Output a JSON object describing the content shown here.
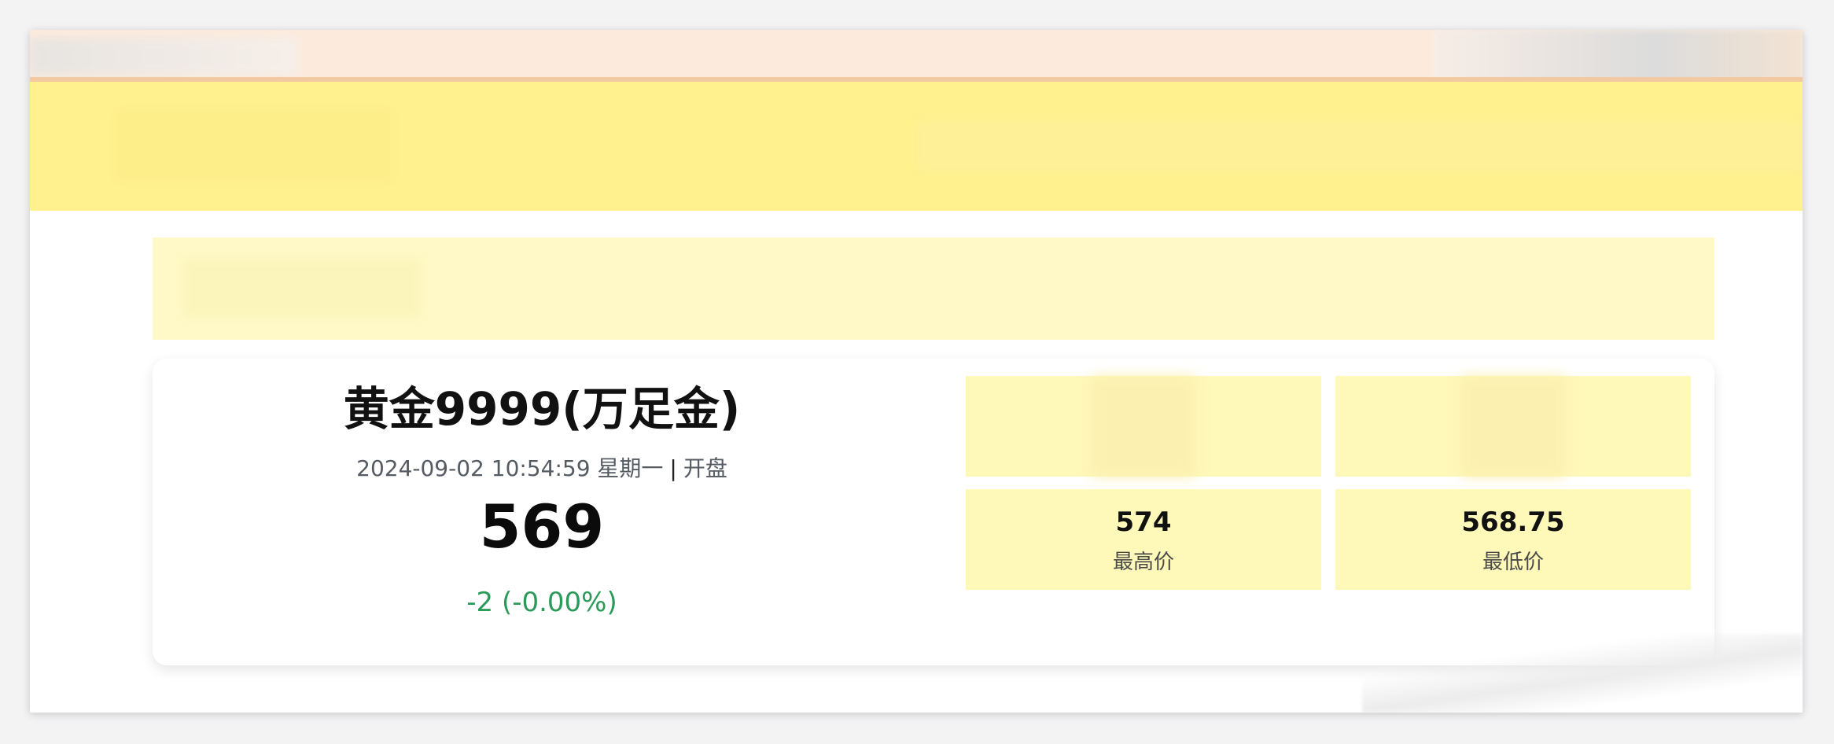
{
  "product": {
    "title": "黄金9999(万足金)",
    "timestamp": "2024-09-02 10:54:59 星期一",
    "separator": "|",
    "status": "开盘",
    "price": "569",
    "change": "-2 (-0.00%)"
  },
  "stats": [
    {
      "value": "",
      "label": ""
    },
    {
      "value": "",
      "label": ""
    },
    {
      "value": "574",
      "label": "最高价"
    },
    {
      "value": "568.75",
      "label": "最低价"
    }
  ],
  "colors": {
    "header_band": "#fef18e",
    "notice_band": "#fef9c6",
    "stat_tile": "#fef8b9",
    "change_down": "#2a9a58",
    "top_strip": "#fcebdd"
  }
}
